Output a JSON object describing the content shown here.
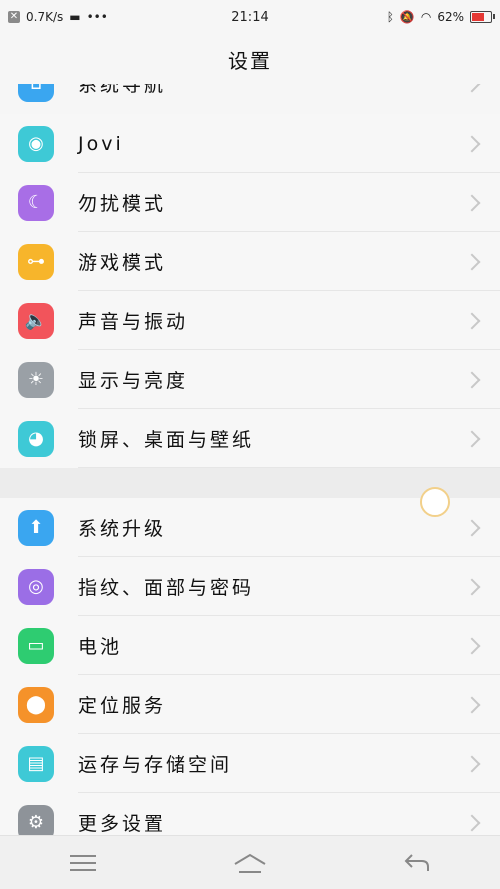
{
  "status": {
    "net_speed": "0.7K/s",
    "time": "21:14",
    "battery": "62%"
  },
  "title": "设置",
  "partial_label": "系统导航",
  "rows_group1": [
    {
      "label": "Jovi",
      "icon": "jovi-icon",
      "color": "#3ec9d6"
    },
    {
      "label": "勿扰模式",
      "icon": "moon-icon",
      "color": "#a86ee6"
    },
    {
      "label": "游戏模式",
      "icon": "gamepad-icon",
      "color": "#f7b52b"
    },
    {
      "label": "声音与振动",
      "icon": "speaker-icon",
      "color": "#f2545b"
    },
    {
      "label": "显示与亮度",
      "icon": "sun-icon",
      "color": "#9aa0a6"
    },
    {
      "label": "锁屏、桌面与壁纸",
      "icon": "palette-icon",
      "color": "#3ec9d6"
    }
  ],
  "rows_group2": [
    {
      "label": "系统升级",
      "icon": "upgrade-icon",
      "color": "#3aa6f0"
    },
    {
      "label": "指纹、面部与密码",
      "icon": "fingerprint-icon",
      "color": "#9b6ee6"
    },
    {
      "label": "电池",
      "icon": "battery-icon",
      "color": "#2ecc71"
    },
    {
      "label": "定位服务",
      "icon": "location-icon",
      "color": "#f5922a"
    },
    {
      "label": "运存与存储空间",
      "icon": "storage-icon",
      "color": "#3ec9d6"
    },
    {
      "label": "更多设置",
      "icon": "gear-icon",
      "color": "#8e9399"
    }
  ]
}
